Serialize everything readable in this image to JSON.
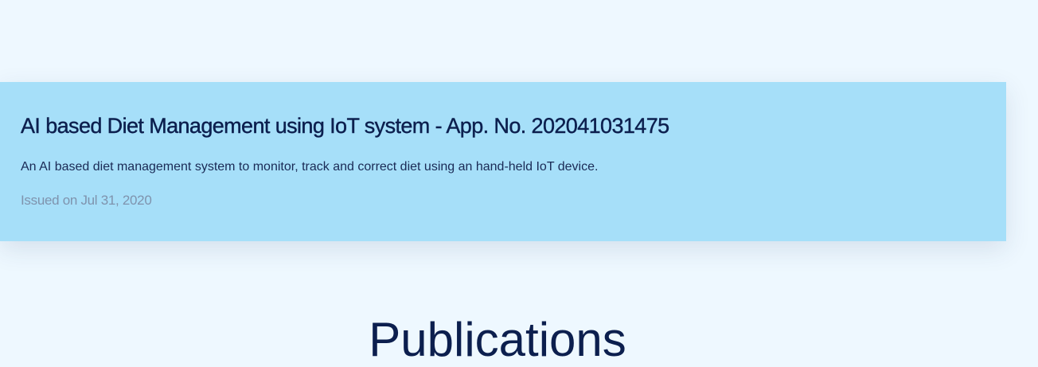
{
  "patent": {
    "title": "AI based Diet Management using IoT system - App. No. 202041031475",
    "description": "An AI based diet management system to monitor, track and correct diet using an hand-held IoT device.",
    "issued": "Issued on Jul 31, 2020"
  },
  "publications": {
    "heading": "Publications"
  },
  "colors": {
    "background": "#eef8ff",
    "card": "#a6dff9",
    "title": "#0c1f4e",
    "date": "#7f93ad"
  }
}
